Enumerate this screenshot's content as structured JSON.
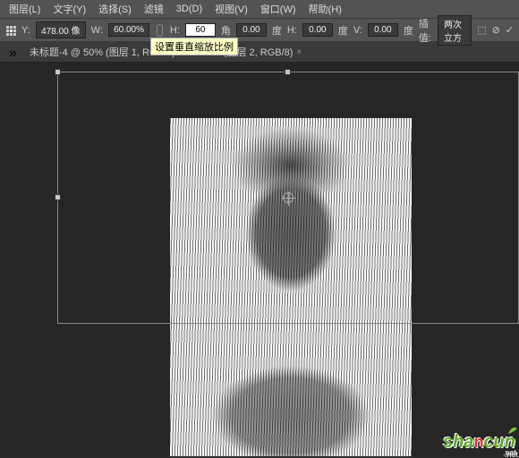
{
  "menu": {
    "items": [
      "图层(L)",
      "文字(Y)",
      "选择(S)",
      "滤镜",
      "3D(D)",
      "视图(V)",
      "窗口(W)",
      "帮助(H)"
    ]
  },
  "options": {
    "y_label": "Y:",
    "y_value": "478.00 像",
    "w_label": "W:",
    "w_value": "60.00%",
    "h_label": "H:",
    "h_value": "60",
    "h_tooltip": "设置垂直缩放比例",
    "angle_label": "角",
    "angle_value": "0.00",
    "angle_unit": "度",
    "skew_h_label": "H:",
    "skew_h_value": "0.00",
    "skew_h_unit": "度",
    "skew_v_label": "V:",
    "skew_v_value": "0.00",
    "skew_v_unit": "度",
    "interp_label": "插值:",
    "interp_value": "两次立方"
  },
  "tabs": [
    {
      "label": "未标题-4 @ 50% (图层 1, RGB/8) *"
    },
    {
      "label": "7% (图层 2, RGB/8)"
    }
  ],
  "watermark": {
    "text_a": "sha",
    "text_b": "n",
    "text_c": "cun",
    "suffix": ".net"
  }
}
